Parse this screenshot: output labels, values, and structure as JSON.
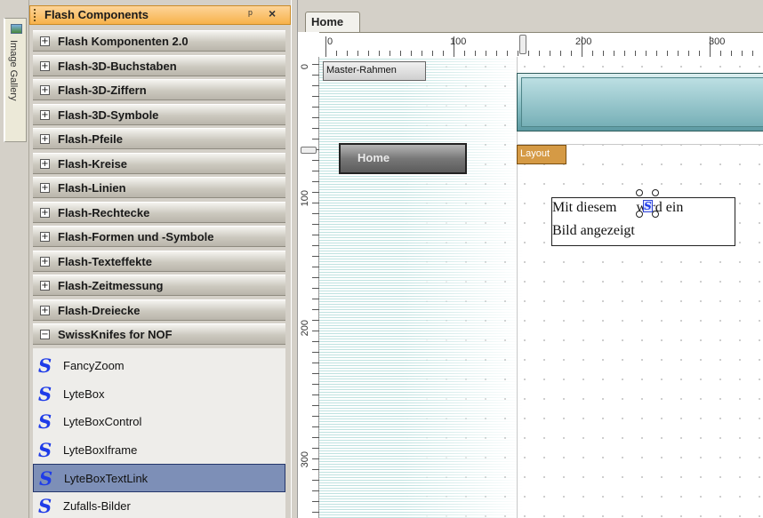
{
  "gallery": {
    "label": "Image Gallery"
  },
  "panel": {
    "title": "Flash Components",
    "pin_symbol": "ᵖ",
    "close_symbol": "×",
    "groups": [
      {
        "label": "Flash Komponenten 2.0",
        "expanded": false
      },
      {
        "label": "Flash-3D-Buchstaben",
        "expanded": false
      },
      {
        "label": "Flash-3D-Ziffern",
        "expanded": false
      },
      {
        "label": "Flash-3D-Symbole",
        "expanded": false
      },
      {
        "label": "Flash-Pfeile",
        "expanded": false
      },
      {
        "label": "Flash-Kreise",
        "expanded": false
      },
      {
        "label": "Flash-Linien",
        "expanded": false
      },
      {
        "label": "Flash-Rechtecke",
        "expanded": false
      },
      {
        "label": "Flash-Formen und -Symbole",
        "expanded": false
      },
      {
        "label": "Flash-Texteffekte",
        "expanded": false
      },
      {
        "label": "Flash-Zeitmessung",
        "expanded": false
      },
      {
        "label": "Flash-Dreiecke",
        "expanded": false
      },
      {
        "label": "SwissKnifes for NOF",
        "expanded": true
      }
    ],
    "expand_symbol": "+",
    "collapse_symbol": "−",
    "items": [
      {
        "label": "FancyZoom",
        "selected": false
      },
      {
        "label": "LyteBox",
        "selected": false
      },
      {
        "label": "LyteBoxControl",
        "selected": false
      },
      {
        "label": "LyteBoxIframe",
        "selected": false
      },
      {
        "label": "LyteBoxTextLink",
        "selected": true
      },
      {
        "label": "Zufalls-Bilder",
        "selected": false
      }
    ],
    "item_icon": "S"
  },
  "editor": {
    "tab": "Home",
    "ruler_h": [
      "0",
      "100",
      "200",
      "300"
    ],
    "ruler_v": [
      "0",
      "100",
      "200",
      "300"
    ],
    "master_button": "Master-Rahmen",
    "home_nav": "Home",
    "layout_button": "Layout",
    "textbox_line1": "Mit diesem",
    "textbox_line1b": "wird ein",
    "textbox_line2": "Bild angezeigt",
    "mini_icon": "S"
  },
  "colors": {
    "accent": "#f7b24a",
    "selection": "#7d8fb7",
    "icon_blue": "#1f3ce8"
  }
}
